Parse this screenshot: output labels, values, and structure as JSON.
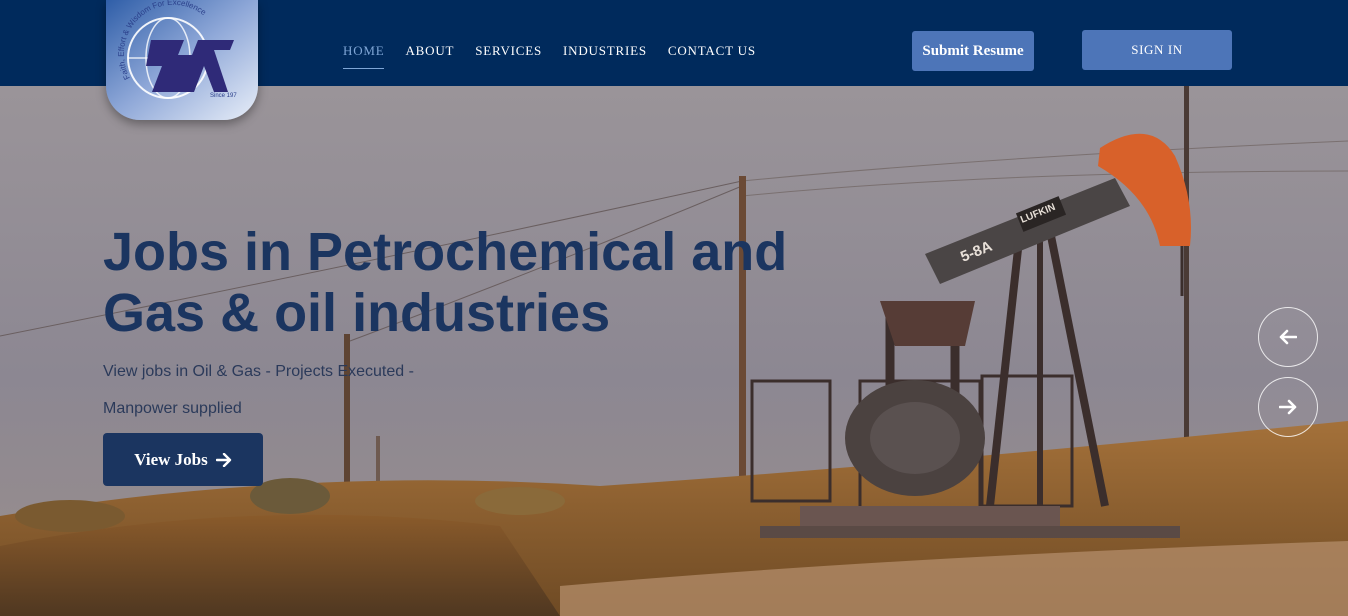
{
  "header": {
    "logo": {
      "tagline": "Faith, Effort & Wisdom For Excellence",
      "since": "Since 197"
    },
    "nav": [
      {
        "label": "HOME",
        "active": true
      },
      {
        "label": "ABOUT",
        "active": false
      },
      {
        "label": "SERVICES",
        "active": false
      },
      {
        "label": "INDUSTRIES",
        "active": false
      },
      {
        "label": "CONTACT US",
        "active": false
      }
    ],
    "submit_resume_label": "Submit Resume",
    "sign_in_label": "SIGN IN"
  },
  "hero": {
    "title_line1": "Jobs in Petrochemical and",
    "title_line2": "Gas & oil industries",
    "subtitle_line1": "View jobs in Oil & Gas - Projects Executed -",
    "subtitle_line2": "Manpower supplied",
    "cta_label": "View Jobs",
    "cta_icon": "arrow-right-icon",
    "pumpjack_label": "5-8A",
    "pumpjack_brand": "LUFKIN",
    "prev_icon": "arrow-left-icon",
    "next_icon": "arrow-right-icon"
  },
  "colors": {
    "header_bg": "#002a5c",
    "accent": "#4d75b8",
    "headline": "#1b3560",
    "active_nav": "#7fa6d6"
  }
}
